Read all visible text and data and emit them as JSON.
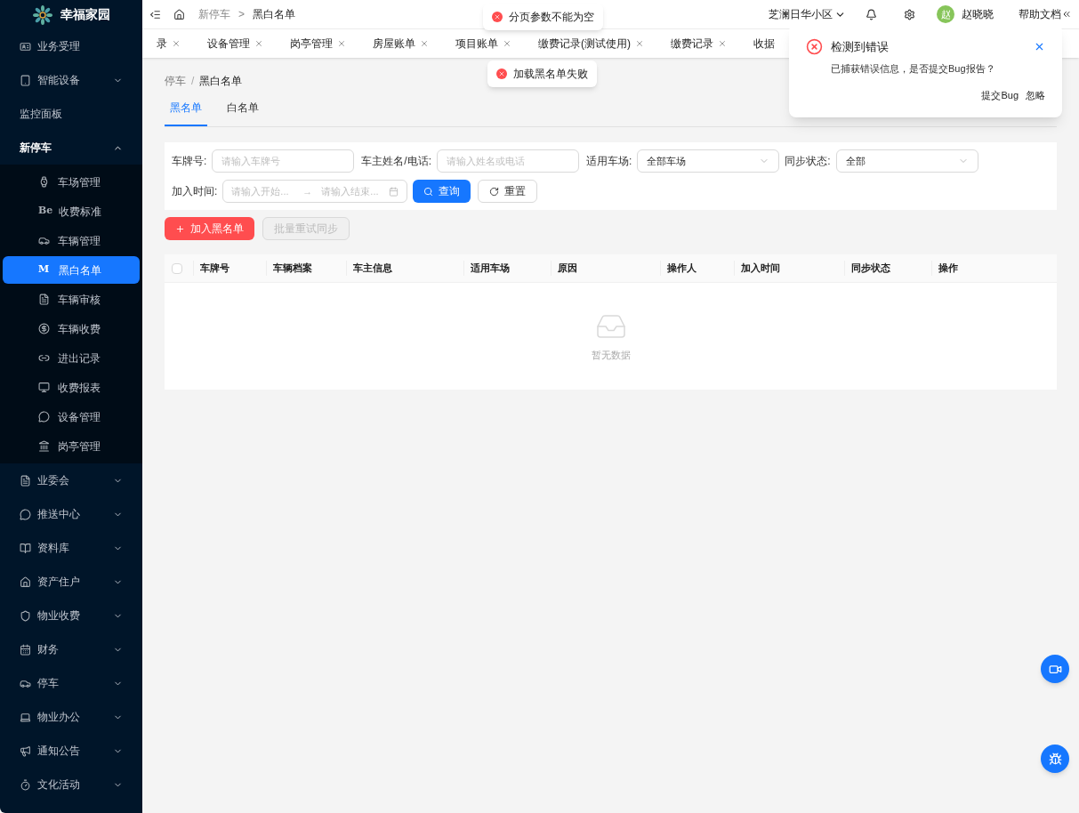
{
  "sidebar": {
    "logo": "幸福家园",
    "items": [
      {
        "label": "业务受理",
        "kind": "link"
      },
      {
        "label": "智能设备",
        "kind": "group",
        "expanded": false
      },
      {
        "label": "监控面板",
        "kind": "plain"
      },
      {
        "label": "新停车",
        "kind": "group",
        "expanded": true,
        "children": [
          {
            "label": "车场管理",
            "selected": false
          },
          {
            "label": "收费标准",
            "glyph": "Be",
            "selected": false
          },
          {
            "label": "车辆管理",
            "selected": false
          },
          {
            "label": "黑白名单",
            "glyph": "M",
            "selected": true
          },
          {
            "label": "车辆审核",
            "selected": false
          },
          {
            "label": "车辆收费",
            "selected": false
          },
          {
            "label": "进出记录",
            "selected": false
          },
          {
            "label": "收费报表",
            "selected": false
          },
          {
            "label": "设备管理",
            "selected": false
          },
          {
            "label": "岗亭管理",
            "selected": false
          }
        ]
      },
      {
        "label": "业委会",
        "kind": "group",
        "expanded": false
      },
      {
        "label": "推送中心",
        "kind": "group",
        "expanded": false
      },
      {
        "label": "资料库",
        "kind": "group",
        "expanded": false
      },
      {
        "label": "资产住户",
        "kind": "group",
        "expanded": false
      },
      {
        "label": "物业收费",
        "kind": "group",
        "expanded": false
      },
      {
        "label": "财务",
        "kind": "group",
        "expanded": false
      },
      {
        "label": "停车",
        "kind": "group",
        "expanded": false
      },
      {
        "label": "物业办公",
        "kind": "group",
        "expanded": false
      },
      {
        "label": "通知公告",
        "kind": "group",
        "expanded": false
      },
      {
        "label": "文化活动",
        "kind": "group",
        "expanded": false
      }
    ]
  },
  "header": {
    "breadcrumb": [
      "新停车",
      "黑白名单"
    ],
    "separator": ">",
    "community": "芝澜日华小区",
    "avatar": "赵",
    "user": "赵晓晓",
    "help": "帮助文档"
  },
  "tabs": [
    {
      "label": "录",
      "closable": true
    },
    {
      "label": "设备管理",
      "closable": true
    },
    {
      "label": "岗亭管理",
      "closable": true
    },
    {
      "label": "房屋账单",
      "closable": true
    },
    {
      "label": "项目账单",
      "closable": true
    },
    {
      "label": "缴费记录(测试使用)",
      "closable": true
    },
    {
      "label": "缴费记录",
      "closable": true
    },
    {
      "label": "收据",
      "closable": false
    }
  ],
  "page": {
    "breadcrumb": [
      "停车",
      "黑白名单"
    ],
    "separator": "/",
    "tabs": [
      {
        "label": "黑名单",
        "selected": true
      },
      {
        "label": "白名单",
        "selected": false
      }
    ],
    "filters": {
      "plate_label": "车牌号:",
      "plate_placeholder": "请输入车牌号",
      "owner_label": "车主姓名/电话:",
      "owner_placeholder": "请输入姓名或电话",
      "lot_label": "适用车场:",
      "lot_value": "全部车场",
      "sync_label": "同步状态:",
      "sync_value": "全部",
      "time_label": "加入时间:",
      "start_placeholder": "请输入开始...",
      "end_placeholder": "请输入结束...",
      "arrow": "→",
      "search": "查询",
      "reset": "重置"
    },
    "actions": [
      {
        "label": "加入黑名单",
        "kind": "primary",
        "disabled": false
      },
      {
        "label": "批量重试同步",
        "kind": "default",
        "disabled": true
      }
    ],
    "table": {
      "select_all_checked": false,
      "columns": [
        "车牌号",
        "车辆档案",
        "车主信息",
        "适用车场",
        "原因",
        "操作人",
        "加入时间",
        "同步状态",
        "操作"
      ],
      "empty": "暂无数据"
    }
  },
  "toasts": [
    "分页参数不能为空",
    "加载黑名单失败"
  ],
  "notification": {
    "title": "检测到错误",
    "body": "已捕获错误信息，是否提交Bug报告？",
    "actions": [
      "提交Bug",
      "忽略"
    ]
  }
}
